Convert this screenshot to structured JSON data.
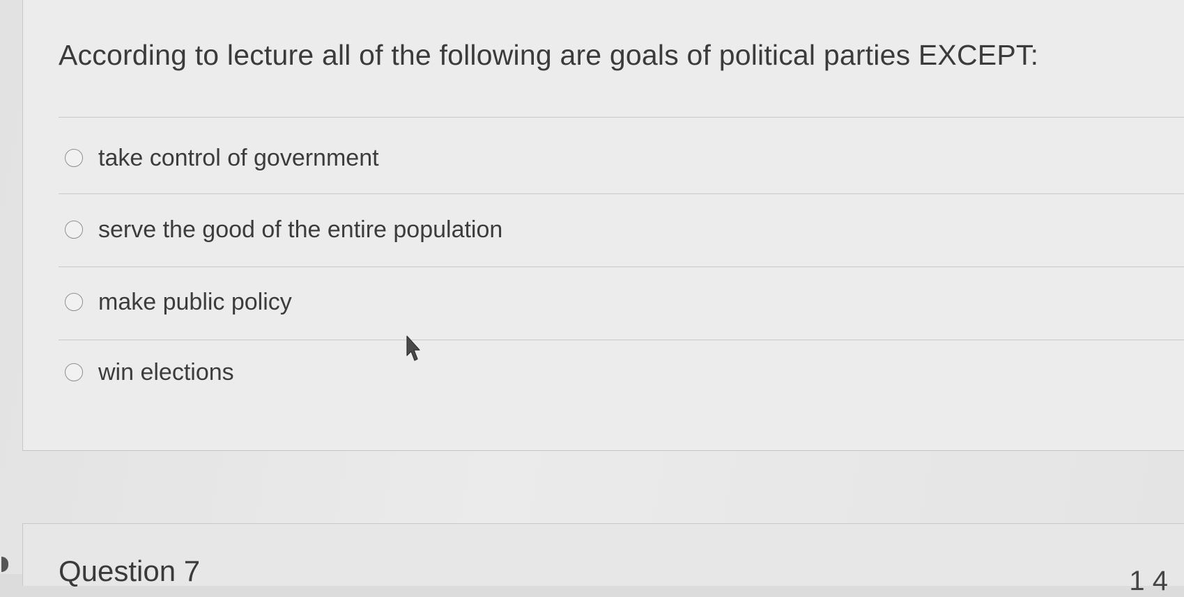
{
  "question": {
    "text": "According to lecture all of the following are goals of political parties EXCEPT:",
    "answers": [
      {
        "label": "take control of government",
        "selected": false
      },
      {
        "label": "serve the good of the entire population",
        "selected": false
      },
      {
        "label": "make public policy",
        "selected": false
      },
      {
        "label": "win elections",
        "selected": false
      }
    ]
  },
  "next_question": {
    "title": "Question 7",
    "points": "1 4"
  },
  "icons": {
    "radio": "radio-button-icon",
    "cursor": "mouse-pointer-icon"
  },
  "colors": {
    "page": "#ececec",
    "text": "#3b3b3b",
    "divider": "#c9c9c9"
  }
}
